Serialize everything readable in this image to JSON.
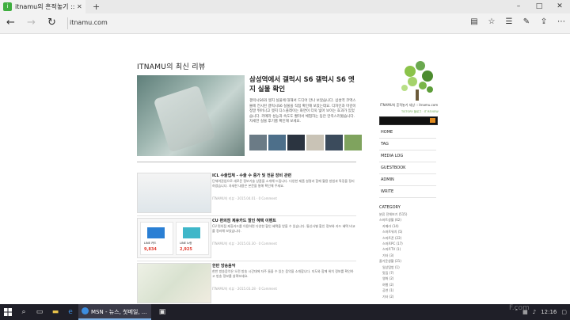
{
  "browser": {
    "tab_title": "itnamu의 흔적놓기 ::",
    "tab_favicon_letter": "i",
    "new_tab_icon": "plus-icon",
    "address": "itnamu.com",
    "window_controls": [
      "–",
      "□",
      "✕"
    ]
  },
  "blog": {
    "heading": "ITNAMU의 최신 리뷰",
    "featured": {
      "title": "삼성역에서 갤럭시 S6 갤럭시 S6 엣지 실물 확인",
      "body": "갤럭시S6와 엣지 실물에 대해서 드디어 만나 보았습니다. 삼성역 코엑스몰에 전시된 갤럭시S6 실물을 직접 확인해 보았는데요. 디자인과 마감이 정말 뛰어나고 엣지 디스플레이는 화면이 더욱 넓어 보이는 효과가 있었습니다. 카메라 성능과 속도도 빨라서 체험하는 동안 만족스러웠습니다. 자세한 실물 후기를 확인해 보세요."
    },
    "posts": [
      {
        "title": "ICL 수출업체 - 수출 수 증가 및 전문 장비 관련",
        "body": "단체여권업으로 새로운 정보기술 상품을 소개해 드립니다. 다양한 제품 설명과 함께 활용 방법과 특징을 정리하였습니다. 자세한 내용은 본문을 통해 확인해 주세요.",
        "meta": "ITNAMU의 리뷰 · 2015.04.01 · 0 Comment"
      },
      {
        "title": "CU 편의점 제휴카드 할인 혜택 이벤트",
        "body": "CU 편의점 제휴카드를 이용하면 다양한 할인 혜택을 받을 수 있습니다. 통신사별 할인 정보와 카드 혜택 비교를 정리해 보았습니다.",
        "meta": "ITNAMU의 리뷰 · 2015.03.30 · 0 Comment",
        "label_a": "LINE 카드",
        "price_a": "9,834",
        "label_b": "LINE 노랑",
        "price_b": "2,925"
      },
      {
        "title": "한반 방송음악",
        "body": "한반 방송음악은 오전 방송 시간대에 자주 들을 수 있는 음악을 소개합니다. 지도와 함께 위치 정보를 확인하고 방송 정보를 살펴보세요.",
        "meta": "ITNAMU의 리뷰 · 2015.03.28 · 0 Comment"
      }
    ]
  },
  "sidebar": {
    "site_name": "ITNAMU의 흔적놓기 세상 :: itnamu.com",
    "site_tag": "TISTORY 블로그 · IT REVIEW",
    "menu": [
      "HOME",
      "TAG",
      "MEDIA LOG",
      "GUESTBOOK",
      "ADMIN",
      "WRITE"
    ],
    "category_title": "CATEGORY",
    "categories": [
      "분류 전체보기 (515)",
      "스마트생활 (62)",
      "　카메라 (14)",
      "　스마트워치 (5)",
      "　스마트폰 (22)",
      "　스마트PC (17)",
      "　스마트TV (1)",
      "　기타 (3)",
      "즐거운생활 (21)",
      "　일상탐방 (1)",
      "　맛집 (7)",
      "　영화 (2)",
      "　여행 (2)",
      "　공연 (1)",
      "　기타 (2)"
    ]
  },
  "taskbar": {
    "active_app_label": "MSN - 뉴스, 첫메일, ...",
    "clock": "12:16",
    "watermark": "F.com"
  },
  "colors": {
    "accent_green": "#6aa84f",
    "search_btn": "#e08a1e",
    "taskbar": "#1f1f28",
    "edge_blue": "#3c8de0"
  }
}
